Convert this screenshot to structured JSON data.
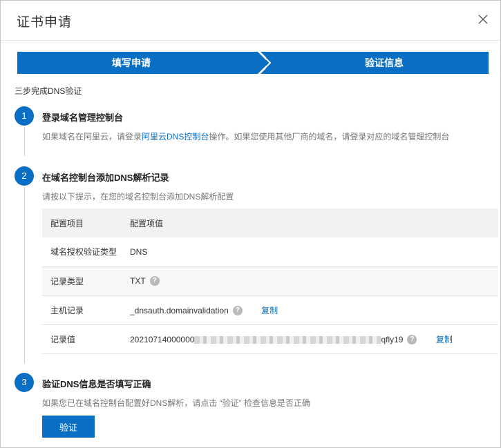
{
  "dialog": {
    "title": "证书申请"
  },
  "steps": [
    {
      "label": "填写申请"
    },
    {
      "label": "验证信息"
    }
  ],
  "subtitle": "三步完成DNS验证",
  "sections": [
    {
      "number": "1",
      "title": "登录域名管理控制台",
      "desc_before": "如果域名在阿里云，请登录",
      "desc_link": "阿里云DNS控制台",
      "desc_after": "操作。如果您使用其他厂商的域名，请登录对应的域名管理控制台"
    },
    {
      "number": "2",
      "title": "在域名控制台添加DNS解析记录",
      "desc": "请按以下提示，在您的域名控制台添加DNS解析配置"
    },
    {
      "number": "3",
      "title": "验证DNS信息是否填写正确",
      "desc": "如果您已在域名控制台配置好DNS解析，请点击 “验证” 检查信息是否正确"
    }
  ],
  "table": {
    "headers": [
      "配置项目",
      "配置项值"
    ],
    "rows": [
      {
        "item": "域名授权验证类型",
        "value": "DNS"
      },
      {
        "item": "记录类型",
        "value": "TXT"
      },
      {
        "item": "主机记录",
        "value": "_dnsauth.domainvalidation",
        "copy": "复制"
      },
      {
        "item": "记录值",
        "value_prefix": "20210714000000",
        "value_suffix": "qfly19",
        "copy": "复制"
      }
    ]
  },
  "verify_button": "验证",
  "colors": {
    "primary": "#0a6ec5",
    "help_icon": "#b9b9b9"
  },
  "icons": {
    "close": "close-icon",
    "help": "question-circle-icon"
  }
}
